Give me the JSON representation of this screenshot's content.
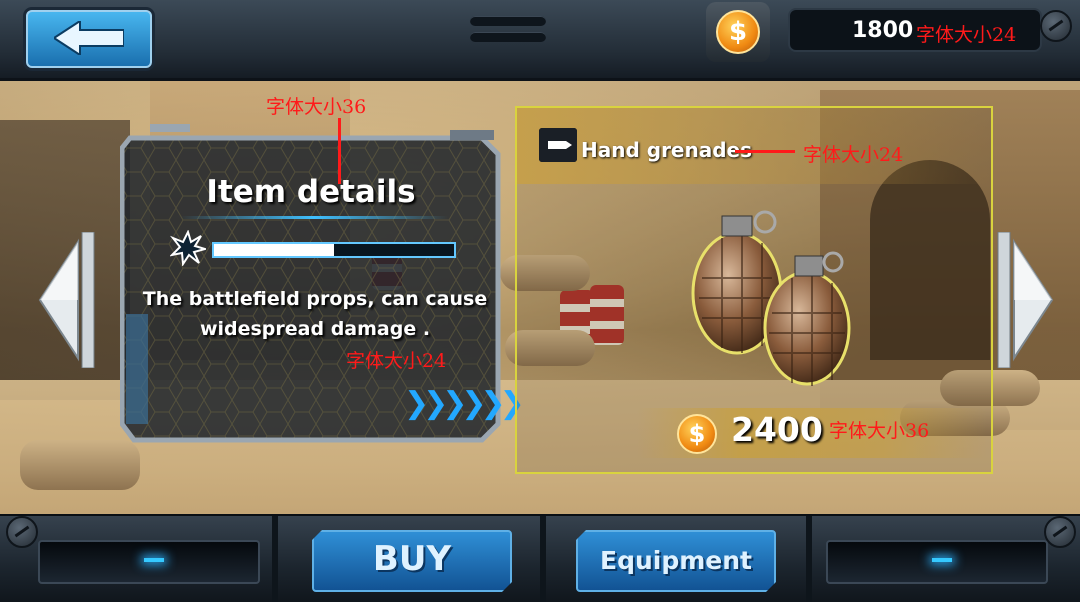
{
  "header": {
    "coins": "1800",
    "coins_annotation": "字体大小24"
  },
  "details_panel": {
    "title": "Item details",
    "title_annotation": "字体大小36",
    "power_level": 0.5,
    "description": "The battlefield props, can cause widespread damage .",
    "description_annotation": "字体大小24",
    "more_glyph": "❯❯❯❯❯❯"
  },
  "item": {
    "name": "Hand grenades",
    "name_annotation": "字体大小24",
    "price": "2400",
    "price_annotation": "字体大小36"
  },
  "coin_symbol": "$",
  "footer": {
    "buy_label": "BUY",
    "equipment_label": "Equipment"
  },
  "icons": {
    "back": "back-arrow-icon",
    "menu": "menu-icon",
    "coin": "coin-icon",
    "prev": "prev-arrow-icon",
    "next": "next-arrow-icon",
    "burst": "explosion-icon",
    "bullet": "bullet-icon",
    "item_image": "grenade-image"
  },
  "colors": {
    "accent_blue": "#2a9de0",
    "gold": "#d9d33e",
    "annotation_red": "#ff1a1a"
  }
}
